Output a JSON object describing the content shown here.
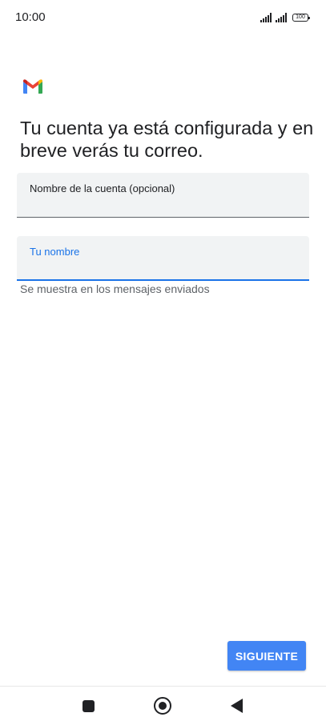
{
  "status_bar": {
    "time": "10:00",
    "battery": "100"
  },
  "logo": {
    "icon": "gmail-logo-icon",
    "colors": {
      "red": "#ea4335",
      "blue": "#4285f4",
      "green": "#34a853",
      "yellow": "#fbbc04",
      "dark_red": "#c5221f"
    }
  },
  "headline": "Tu cuenta ya está configurada y en breve verás tu correo.",
  "form": {
    "account_name": {
      "label": "Nombre de la cuenta (opcional)",
      "value": ""
    },
    "your_name": {
      "label": "Tu nombre",
      "value": "",
      "helper": "Se muestra en los mensajes enviados"
    }
  },
  "actions": {
    "next_label": "SIGUIENTE"
  },
  "nav": {
    "recent_icon": "square-icon",
    "home_icon": "circle-icon",
    "back_icon": "back-triangle-icon"
  },
  "colors": {
    "accent": "#1a73e8",
    "button": "#4285f4",
    "field_bg": "#f1f3f4"
  }
}
